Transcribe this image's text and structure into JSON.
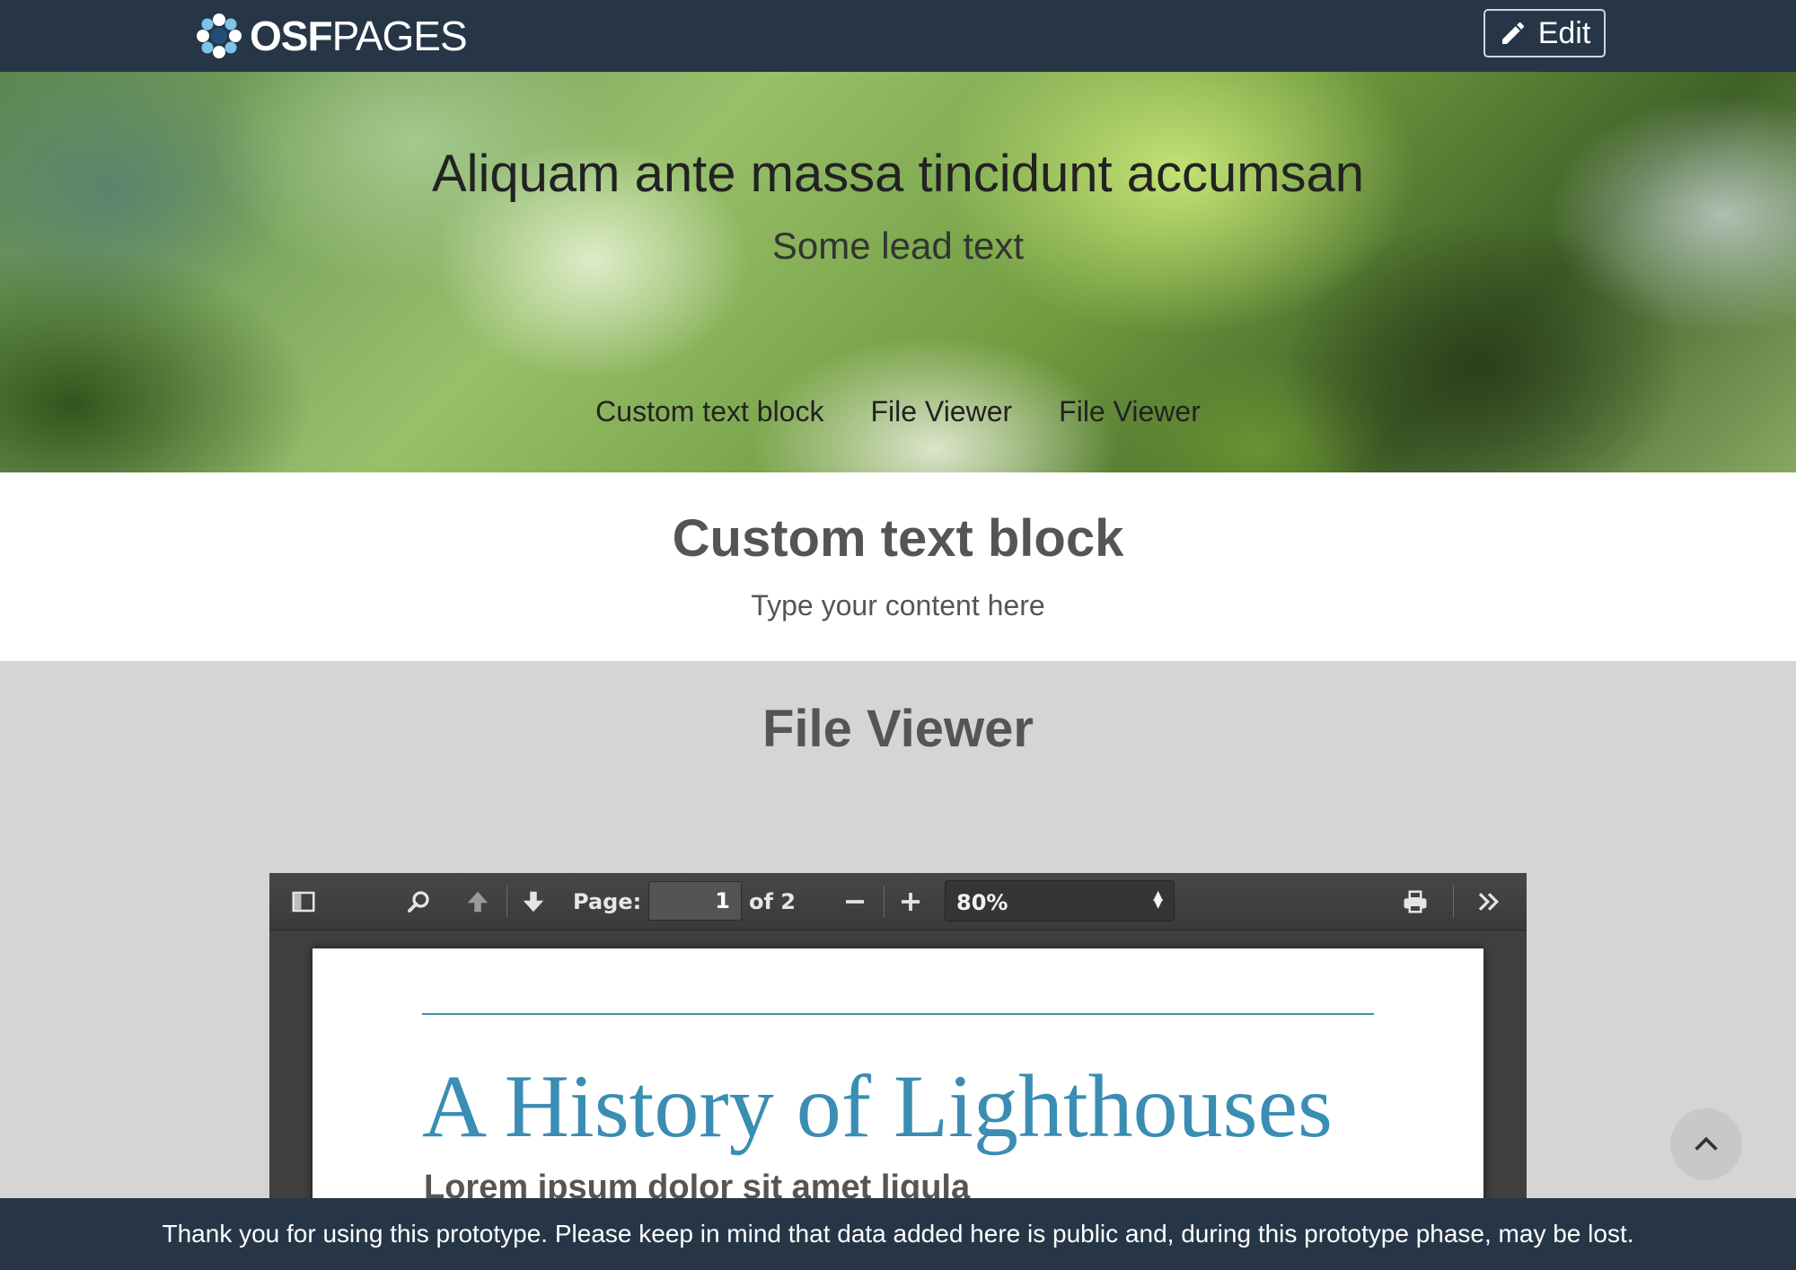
{
  "navbar": {
    "brand_bold": "OSF",
    "brand_rest": "PAGES",
    "edit_label": "Edit"
  },
  "hero": {
    "title": "Aliquam ante massa tincidunt accumsan",
    "lead": "Some lead text",
    "nav": [
      "Custom text block",
      "File Viewer",
      "File Viewer"
    ]
  },
  "text_block": {
    "title": "Custom text block",
    "body": "Type your content here"
  },
  "file_viewer": {
    "title": "File Viewer",
    "toolbar": {
      "page_label": "Page:",
      "page_value": "1",
      "page_total": "of 2",
      "zoom_value": "80%"
    },
    "document": {
      "title": "A History of Lighthouses",
      "subtitle": "Lorem ipsum dolor sit amet ligula",
      "accent_color": "#3a8db3"
    }
  },
  "footer": {
    "notice": "Thank you for using this prototype. Please keep in mind that data added here is public and, during this prototype phase, may be lost."
  },
  "colors": {
    "navbar": "#263647",
    "section_gray": "#d5d5d5"
  }
}
